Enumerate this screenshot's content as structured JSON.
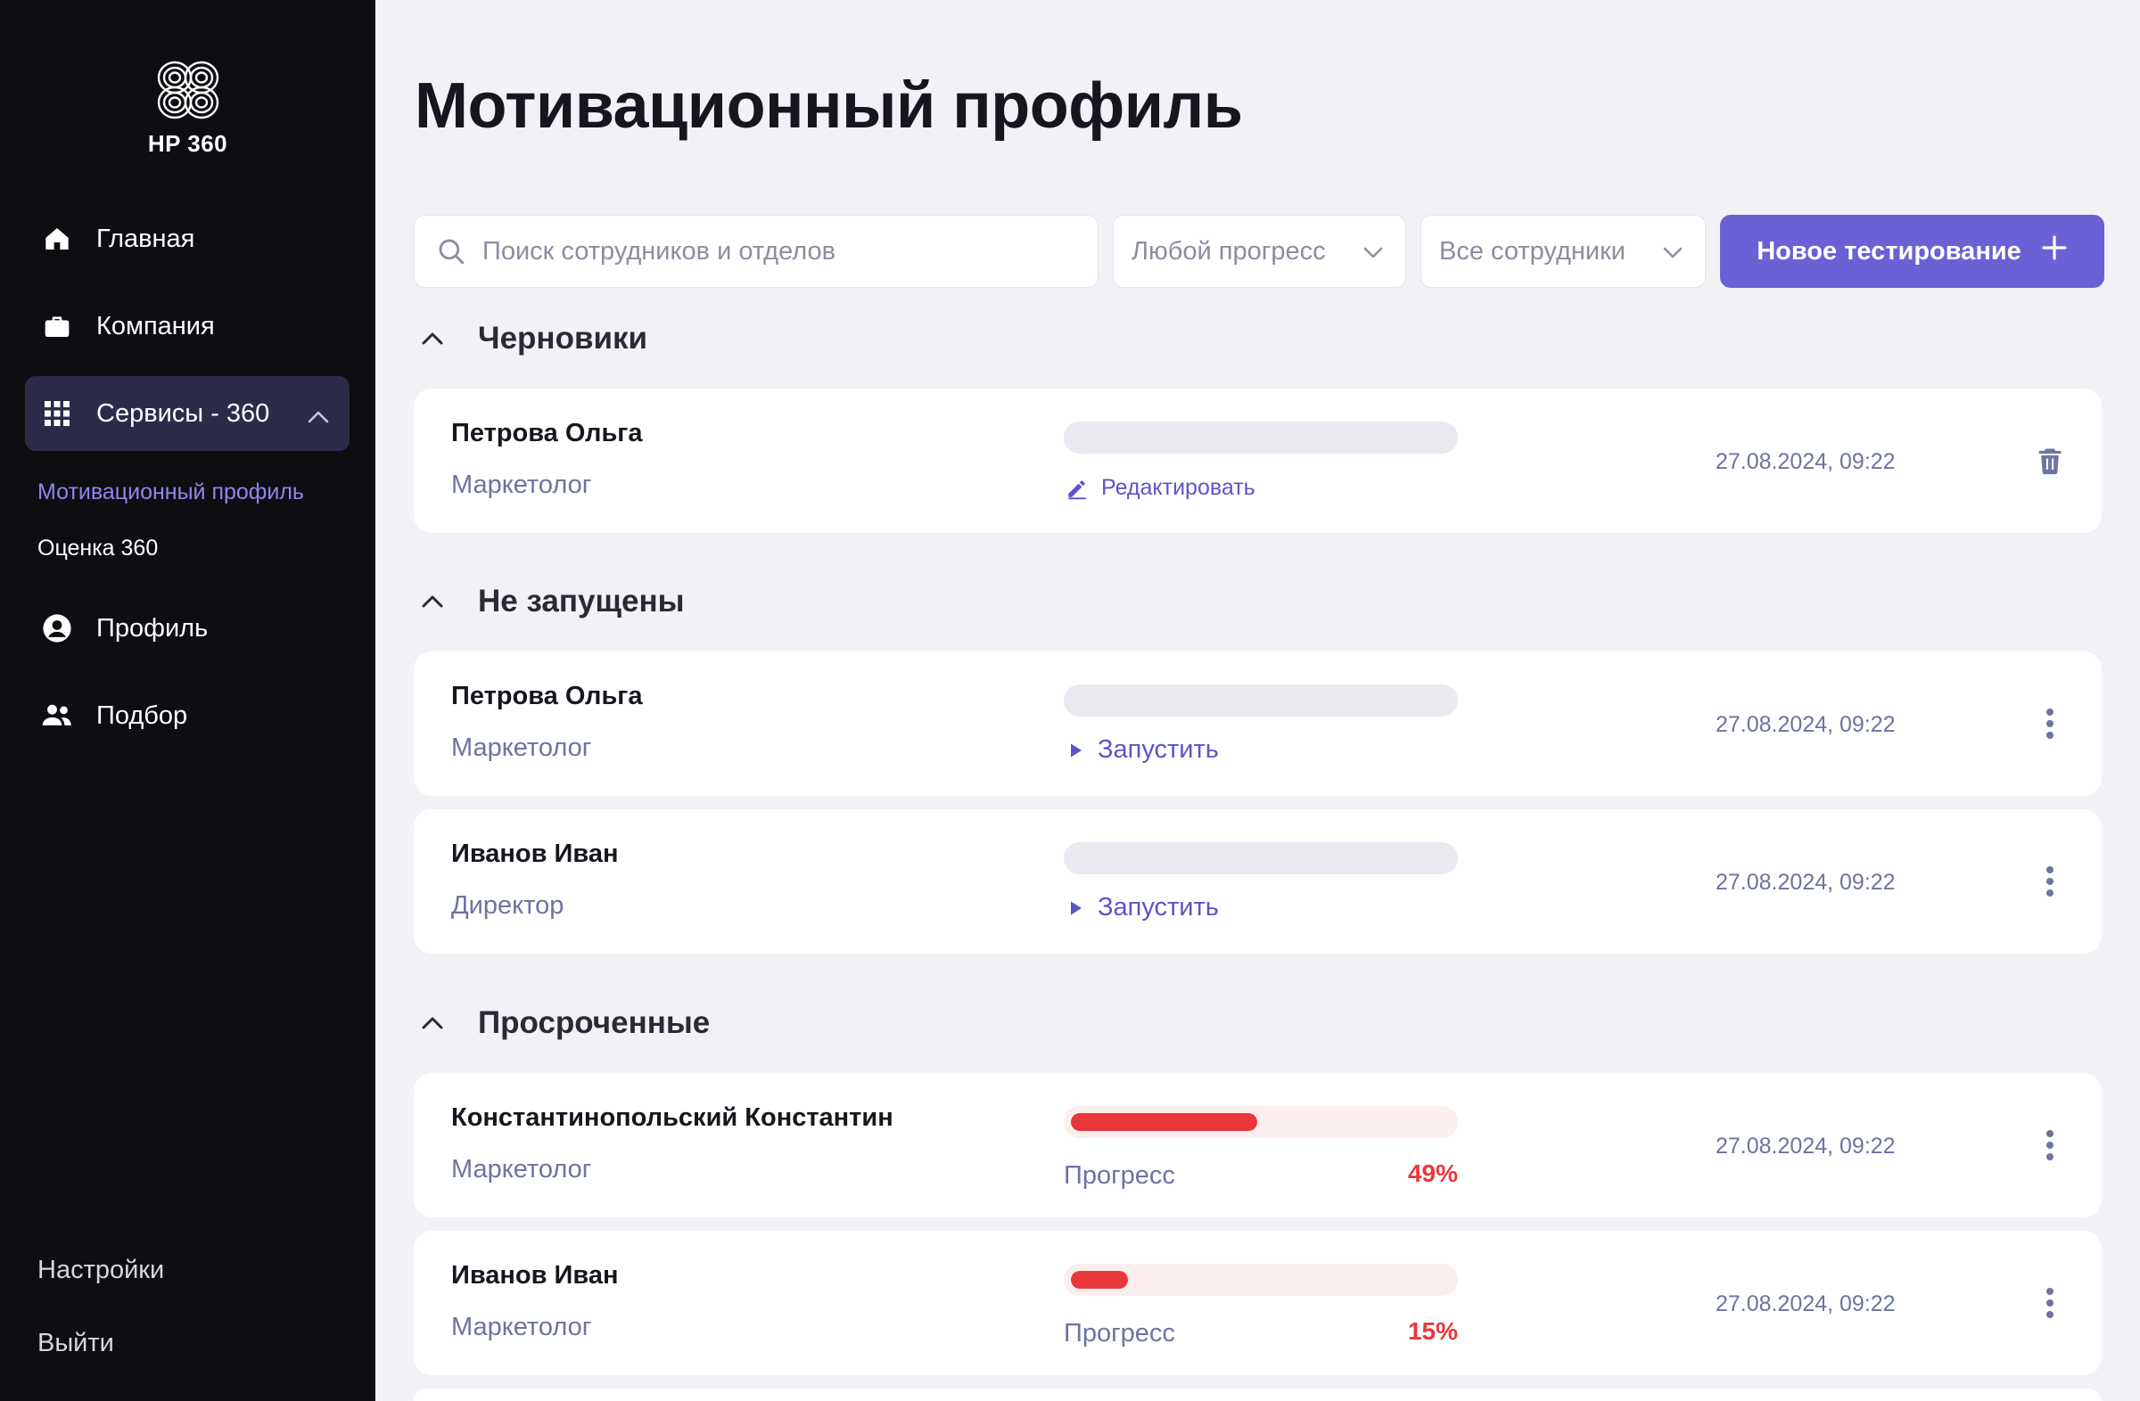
{
  "sidebar": {
    "logo_text": "HP 360",
    "nav": [
      {
        "label": "Главная",
        "icon": "home-icon"
      },
      {
        "label": "Компания",
        "icon": "briefcase-icon"
      },
      {
        "label": "Сервисы - 360",
        "icon": "grid-icon",
        "expanded": true
      },
      {
        "label": "Профиль",
        "icon": "user-circle-icon"
      },
      {
        "label": "Подбор",
        "icon": "users-icon"
      }
    ],
    "sub_items": [
      {
        "label": "Мотивационный профиль",
        "active": true
      },
      {
        "label": "Оценка 360",
        "active": false
      }
    ],
    "settings_label": "Настройки",
    "logout_label": "Выйти"
  },
  "main": {
    "title": "Мотивационный профиль",
    "search_placeholder": "Поиск сотрудников и отделов",
    "filter_progress": "Любой прогресс",
    "filter_employees": "Все сотрудники",
    "new_test_label": "Новое тестирование",
    "sections": [
      {
        "title": "Черновики",
        "rows": [
          {
            "name": "Петрова Ольга",
            "role": "Маркетолог",
            "action": "Редактировать",
            "date": "27.08.2024, 09:22",
            "menu": "trash-icon"
          }
        ]
      },
      {
        "title": "Не запущены",
        "rows": [
          {
            "name": "Петрова Ольга",
            "role": "Маркетолог",
            "action": "Запустить",
            "date": "27.08.2024, 09:22",
            "menu": "more-vertical-icon"
          },
          {
            "name": "Иванов Иван",
            "role": "Директор",
            "action": "Запустить",
            "date": "27.08.2024, 09:22",
            "menu": "more-vertical-icon"
          }
        ]
      },
      {
        "title": "Просроченные",
        "rows": [
          {
            "name": "Константинопольский Константин",
            "role": "Маркетолог",
            "progress_label": "Прогресс",
            "progress_text": "49%",
            "progress": 0.49,
            "date": "27.08.2024, 09:22",
            "menu": "more-vertical-icon"
          },
          {
            "name": "Иванов Иван",
            "role": "Маркетолог",
            "progress_label": "Прогресс",
            "progress_text": "15%",
            "progress": 0.15,
            "date": "27.08.2024, 09:22",
            "menu": "more-vertical-icon"
          }
        ]
      }
    ]
  },
  "colors": {
    "accent": "#6a61d6",
    "danger": "#e8383c",
    "sidebar_bg": "#0d0d12",
    "page_bg": "#f2f1f6"
  }
}
